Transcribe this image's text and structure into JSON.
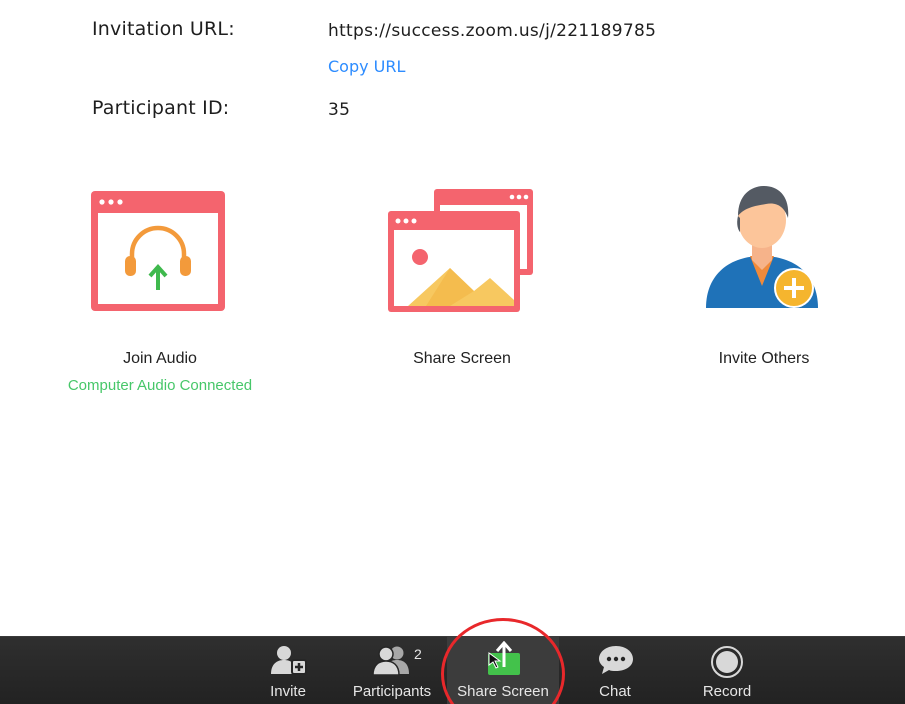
{
  "info": {
    "invitation_url_label": "Invitation URL:",
    "invitation_url_value": "https://success.zoom.us/j/221189785",
    "copy_url_label": "Copy URL",
    "participant_id_label": "Participant ID:",
    "participant_id_value": "35"
  },
  "actions": {
    "join_audio_label": "Join Audio",
    "join_audio_status": "Computer Audio Connected",
    "share_screen_label": "Share Screen",
    "invite_others_label": "Invite Others"
  },
  "toolbar": {
    "invite_label": "Invite",
    "participants_label": "Participants",
    "participants_count": "2",
    "share_screen_label": "Share Screen",
    "chat_label": "Chat",
    "record_label": "Record"
  },
  "colors": {
    "accent_blue": "#2d8cff",
    "status_green": "#47c769",
    "tile_red": "#f4646e",
    "share_green": "#43c24b",
    "annotation_red": "#e8282b",
    "toolbar_bg": "#262626"
  },
  "icons": {
    "join_audio": "headphones-upload-icon",
    "share_screen": "screen-windows-icon",
    "invite_others": "user-add-icon",
    "invite": "person-plus-icon",
    "participants": "people-icon",
    "share": "share-up-arrow-icon",
    "chat": "speech-bubble-icon",
    "record": "record-circle-icon"
  }
}
